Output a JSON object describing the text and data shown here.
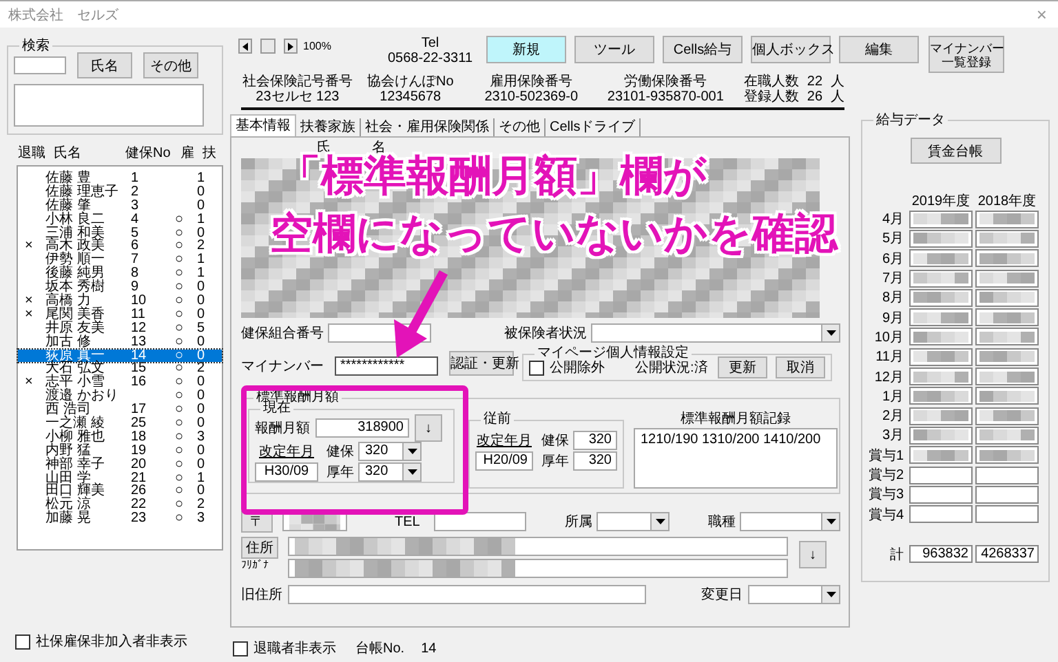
{
  "window": {
    "title": "株式会社　セルズ",
    "close": "×"
  },
  "search": {
    "legend": "検索",
    "buttons": [
      "氏名",
      "その他"
    ]
  },
  "employee_list": {
    "columns": [
      "退職",
      "氏名",
      "健保No",
      "雇",
      "扶"
    ],
    "rows": [
      {
        "retired": "",
        "name": "佐藤 豊",
        "no": "1",
        "koyo": "",
        "fuyo": "1",
        "selected": false
      },
      {
        "retired": "",
        "name": "佐藤 理恵子",
        "no": "2",
        "koyo": "",
        "fuyo": "0",
        "selected": false
      },
      {
        "retired": "",
        "name": "佐藤 肇",
        "no": "3",
        "koyo": "",
        "fuyo": "0",
        "selected": false
      },
      {
        "retired": "",
        "name": "小林 良二",
        "no": "4",
        "koyo": "○",
        "fuyo": "1",
        "selected": false
      },
      {
        "retired": "",
        "name": "三浦 和美",
        "no": "5",
        "koyo": "○",
        "fuyo": "0",
        "selected": false
      },
      {
        "retired": "×",
        "name": "高木 政美",
        "no": "6",
        "koyo": "○",
        "fuyo": "2",
        "selected": false
      },
      {
        "retired": "",
        "name": "伊勢 順一",
        "no": "7",
        "koyo": "○",
        "fuyo": "1",
        "selected": false
      },
      {
        "retired": "",
        "name": "後藤 純男",
        "no": "8",
        "koyo": "○",
        "fuyo": "1",
        "selected": false
      },
      {
        "retired": "",
        "name": "坂本 秀樹",
        "no": "9",
        "koyo": "○",
        "fuyo": "0",
        "selected": false
      },
      {
        "retired": "×",
        "name": "高橋 力",
        "no": "10",
        "koyo": "○",
        "fuyo": "0",
        "selected": false
      },
      {
        "retired": "×",
        "name": "尾関 美香",
        "no": "11",
        "koyo": "○",
        "fuyo": "0",
        "selected": false
      },
      {
        "retired": "",
        "name": "井原 友美",
        "no": "12",
        "koyo": "○",
        "fuyo": "5",
        "selected": false
      },
      {
        "retired": "",
        "name": "加古 修",
        "no": "13",
        "koyo": "○",
        "fuyo": "0",
        "selected": false
      },
      {
        "retired": "",
        "name": "荻原 真一",
        "no": "14",
        "koyo": "○",
        "fuyo": "0",
        "selected": true
      },
      {
        "retired": "",
        "name": "大石 弘文",
        "no": "15",
        "koyo": "○",
        "fuyo": "2",
        "selected": false
      },
      {
        "retired": "×",
        "name": "志平 小雪",
        "no": "16",
        "koyo": "○",
        "fuyo": "0",
        "selected": false
      },
      {
        "retired": "",
        "name": "渡邉 かおり",
        "no": "",
        "koyo": "○",
        "fuyo": "0",
        "selected": false
      },
      {
        "retired": "",
        "name": "西 浩司",
        "no": "17",
        "koyo": "○",
        "fuyo": "0",
        "selected": false
      },
      {
        "retired": "",
        "name": "一之瀬 綾",
        "no": "25",
        "koyo": "○",
        "fuyo": "0",
        "selected": false
      },
      {
        "retired": "",
        "name": "小柳 雅也",
        "no": "18",
        "koyo": "○",
        "fuyo": "3",
        "selected": false
      },
      {
        "retired": "",
        "name": "内野 猛",
        "no": "19",
        "koyo": "○",
        "fuyo": "0",
        "selected": false
      },
      {
        "retired": "",
        "name": "神部 幸子",
        "no": "20",
        "koyo": "○",
        "fuyo": "0",
        "selected": false
      },
      {
        "retired": "",
        "name": "山田 学",
        "no": "21",
        "koyo": "○",
        "fuyo": "1",
        "selected": false
      },
      {
        "retired": "",
        "name": "田口 輝美",
        "no": "26",
        "koyo": "○",
        "fuyo": "0",
        "selected": false
      },
      {
        "retired": "",
        "name": "松元 涼",
        "no": "22",
        "koyo": "○",
        "fuyo": "2",
        "selected": false
      },
      {
        "retired": "",
        "name": "加藤 晃",
        "no": "23",
        "koyo": "○",
        "fuyo": "3",
        "selected": false
      }
    ]
  },
  "hide_uninsured": {
    "label": "社保雇保非加入者非表示",
    "checked": false
  },
  "toolbar": {
    "zoom": "100%",
    "tel_label": "Tel",
    "tel": "0568-22-3311",
    "buttons": [
      {
        "lines": [
          "新規"
        ],
        "highlighted": true
      },
      {
        "lines": [
          "ツール"
        ],
        "highlighted": false
      },
      {
        "lines": [
          "Cells給与"
        ],
        "highlighted": false
      },
      {
        "lines": [
          "個人ボックス"
        ],
        "highlighted": false
      },
      {
        "lines": [
          "編集"
        ],
        "highlighted": false
      },
      {
        "lines": [
          "マイナンバー",
          "一覧登録"
        ],
        "highlighted": false
      }
    ]
  },
  "company_info": [
    {
      "label": "社会保険記号番号",
      "value": "23セルセ 123"
    },
    {
      "label": "協会けんぽNo",
      "value": "12345678"
    },
    {
      "label": "雇用保険番号",
      "value": "2310-502369-0"
    },
    {
      "label": "労働保険番号",
      "value": "23101-935870-001"
    }
  ],
  "counts": [
    {
      "label": "在職人数",
      "value": "22",
      "unit": "人"
    },
    {
      "label": "登録人数",
      "value": "26",
      "unit": "人"
    }
  ],
  "tabs": [
    {
      "label": "基本情報",
      "selected": true
    },
    {
      "label": "扶養家族",
      "selected": false
    },
    {
      "label": "社会・雇用保険関係",
      "selected": false
    },
    {
      "label": "その他",
      "selected": false
    },
    {
      "label": "Cellsドライブ",
      "selected": false
    }
  ],
  "basic_info": {
    "name_labels": [
      "氏",
      "名"
    ],
    "union_no_label": "健保組合番号",
    "insured_status_label": "被保険者状況",
    "my_number_label": "マイナンバー",
    "my_number": "************",
    "auth_button": "認証・更新",
    "mypage": {
      "legend": "マイページ個人情報設定",
      "exclude_label": "公開除外",
      "exclude_checked": false,
      "status": "公開状況:済",
      "buttons": [
        "更新",
        "取消"
      ]
    },
    "standard_pay": {
      "legend": "標準報酬月額",
      "current": {
        "legend": "現在",
        "amount_label": "報酬月額",
        "amount": "318900",
        "down_button": "↓",
        "revision_label": "改定年月",
        "revision": "H30/09",
        "health_label": "健保",
        "health": "320",
        "pension_label": "厚年",
        "pension": "320"
      },
      "previous": {
        "legend": "従前",
        "revision_label": "改定年月",
        "revision": "H20/09",
        "health_label": "健保",
        "health": "320",
        "pension_label": "厚年",
        "pension": "320"
      },
      "history_label": "標準報酬月額記録",
      "history": "1210/190 1310/200 1410/200"
    },
    "address": {
      "postal_button": "〒",
      "tel_label": "TEL",
      "dept_label": "所属",
      "job_label": "職種",
      "address_button": "住所",
      "furigana_label": "ﾌﾘｶﾞﾅ",
      "down_button": "↓",
      "old_address_label": "旧住所",
      "change_date_label": "変更日"
    }
  },
  "footer": {
    "hide_retired_label": "退職者非表示",
    "hide_retired_checked": false,
    "ledger_label": "台帳No.",
    "ledger_no": "14"
  },
  "salary": {
    "legend": "給与データ",
    "ledger_button": "賃金台帳",
    "years": [
      "2019年度",
      "2018年度"
    ],
    "rows": [
      {
        "label": "4月",
        "blurred": true
      },
      {
        "label": "5月",
        "blurred": true
      },
      {
        "label": "6月",
        "blurred": true
      },
      {
        "label": "7月",
        "blurred": true
      },
      {
        "label": "8月",
        "blurred": true
      },
      {
        "label": "9月",
        "blurred": true
      },
      {
        "label": "10月",
        "blurred": true
      },
      {
        "label": "11月",
        "blurred": true
      },
      {
        "label": "12月",
        "blurred": true
      },
      {
        "label": "1月",
        "blurred": true
      },
      {
        "label": "2月",
        "blurred": true
      },
      {
        "label": "3月",
        "blurred": true
      },
      {
        "label": "賞与1",
        "blurred": true
      },
      {
        "label": "賞与2",
        "blurred": false
      },
      {
        "label": "賞与3",
        "blurred": false
      },
      {
        "label": "賞与4",
        "blurred": false
      }
    ],
    "total_label": "計",
    "totals": [
      "963832",
      "4268337"
    ]
  },
  "annotation": {
    "lines": [
      "「標準報酬月額」欄が",
      "空欄になっていないかを確認"
    ]
  }
}
